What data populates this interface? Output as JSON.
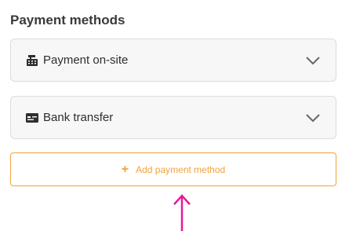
{
  "section": {
    "title": "Payment methods"
  },
  "methods": [
    {
      "label": "Payment on-site",
      "icon": "cash-register-icon"
    },
    {
      "label": "Bank transfer",
      "icon": "bank-card-icon"
    }
  ],
  "add_button": {
    "label": "Add payment method",
    "icon": "plus-icon"
  },
  "colors": {
    "accent": "#f0a33c",
    "annotation_arrow": "#e8189a"
  }
}
